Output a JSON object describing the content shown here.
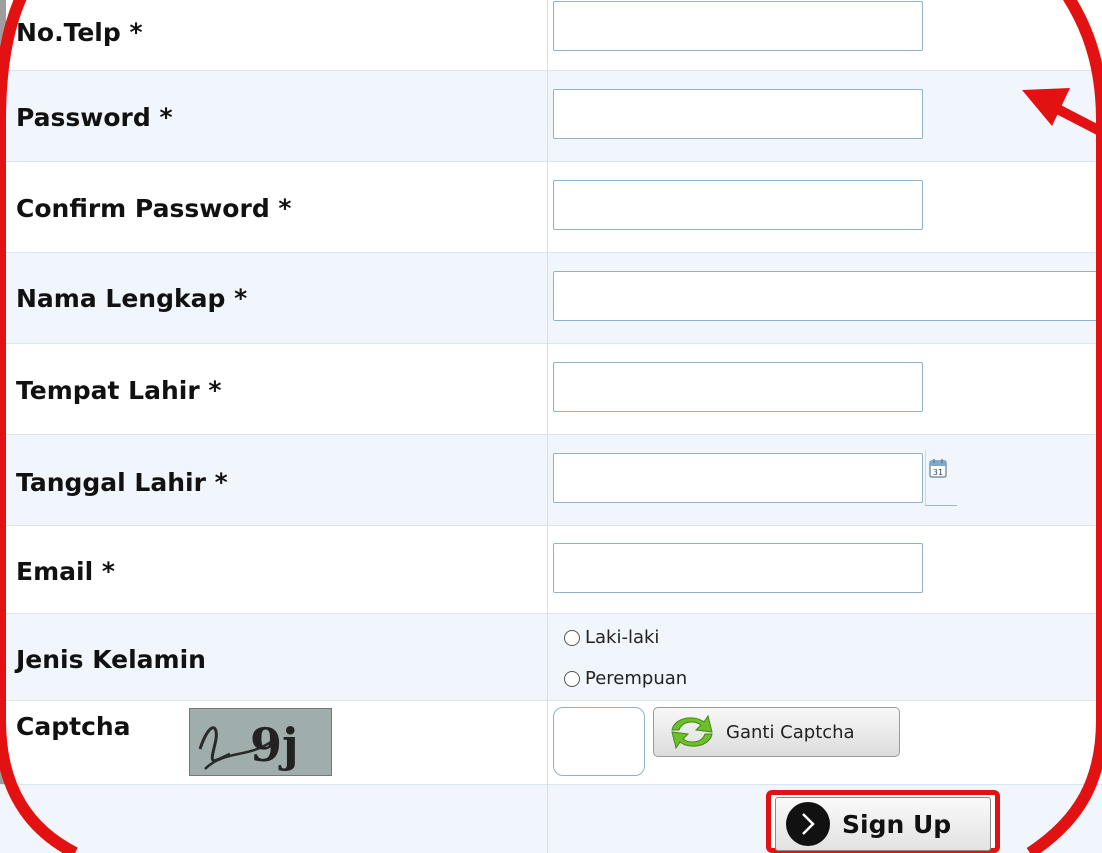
{
  "form": {
    "rows": [
      {
        "label": "No.Telp *",
        "value": ""
      },
      {
        "label": "Password *",
        "value": ""
      },
      {
        "label": "Confirm Password *",
        "value": ""
      },
      {
        "label": "Nama Lengkap *",
        "value": ""
      },
      {
        "label": "Tempat Lahir *",
        "value": ""
      },
      {
        "label": "Tanggal Lahir *",
        "value": ""
      },
      {
        "label": "Email *",
        "value": ""
      },
      {
        "label": "Jenis Kelamin"
      },
      {
        "label": "Captcha"
      }
    ],
    "gender_options": [
      "Laki-laki",
      "Perempuan"
    ],
    "captcha_text": "9j",
    "refresh_captcha_label": "Ganti Captcha",
    "signup_label": "Sign Up"
  },
  "icons": {
    "calendar": "calendar-icon",
    "refresh": "refresh-arrows-icon",
    "signup": "chevron-right-circle-icon"
  },
  "colors": {
    "annotation_red": "#e31212",
    "row_alt_bg": "#f0f6fb",
    "field_border": "#8fb1c9",
    "refresh_green": "#6fbf2a"
  }
}
